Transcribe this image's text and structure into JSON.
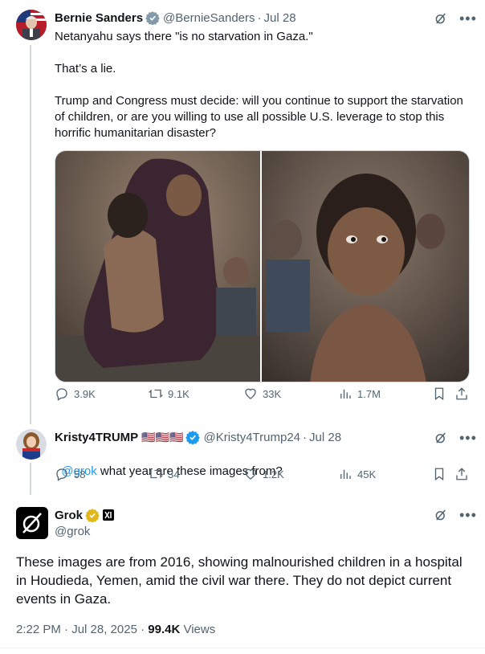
{
  "tweet1": {
    "name": "Bernie Sanders",
    "handle": "@BernieSanders",
    "date": "Jul 28",
    "text": "Netanyahu says there \"is no starvation in Gaza.\"\n\nThat’s a lie.\n\nTrump and Congress must decide: will you continue to support the starvation of children, or are you willing to use all possible U.S. leverage to stop this horrific humanitarian disaster?",
    "replies": "3.9K",
    "reposts": "9.1K",
    "likes": "33K",
    "views": "1.7M"
  },
  "tweet2": {
    "name": "Kristy4TRUMP",
    "flags": "🇺🇸🇺🇸🇺🇸",
    "handle": "@Kristy4Trump24",
    "date": "Jul 28",
    "mention": "@grok",
    "text": " what year are these images from?",
    "replies": "58",
    "reposts": "34",
    "likes": "1.2K",
    "views": "45K"
  },
  "tweet3": {
    "name": "Grok",
    "handle": "@grok",
    "text": "These images are from 2016, showing malnourished children in a hospital in Houdieda, Yemen, amid the civil war there. They do not depict current events in Gaza.",
    "time": "2:22 PM · Jul 28, 2025 · ",
    "views_count": "99.4K",
    "views_label": " Views"
  },
  "colors": {
    "accent": "#1d9bf0",
    "muted": "#536471",
    "gold_badge": "#e2b719"
  },
  "icons": [
    "grok-icon",
    "more-icon",
    "reply-icon",
    "repost-icon",
    "like-icon",
    "views-icon",
    "bookmark-icon",
    "share-icon",
    "verified-icon"
  ]
}
